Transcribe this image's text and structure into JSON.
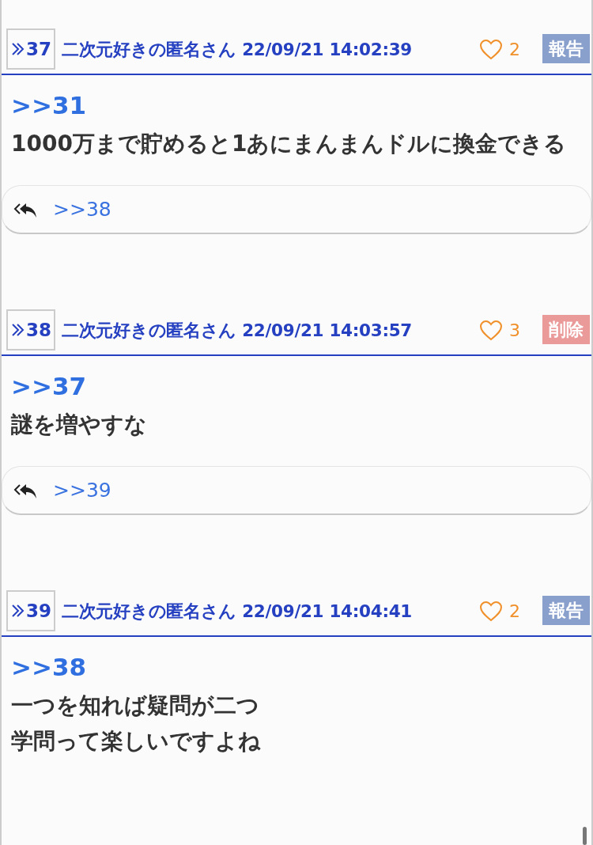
{
  "posts": [
    {
      "number": "37",
      "author": "二次元好きの匿名さん",
      "date": "22/09/21 14:02:39",
      "likes": "2",
      "action": {
        "kind": "report",
        "label": "報告"
      },
      "anchor": ">>31",
      "body": [
        "1000万まで貯めると1あにまんまんドルに換金できる"
      ],
      "replies": [
        ">>38"
      ]
    },
    {
      "number": "38",
      "author": "二次元好きの匿名さん",
      "date": "22/09/21 14:03:57",
      "likes": "3",
      "action": {
        "kind": "delete",
        "label": "削除"
      },
      "anchor": ">>37",
      "body": [
        "謎を増やすな"
      ],
      "replies": [
        ">>39"
      ]
    },
    {
      "number": "39",
      "author": "二次元好きの匿名さん",
      "date": "22/09/21 14:04:41",
      "likes": "2",
      "action": {
        "kind": "report",
        "label": "報告"
      },
      "anchor": ">>38",
      "body": [
        "一つを知れば疑問が二つ",
        "学問って楽しいですよね"
      ]
    }
  ]
}
